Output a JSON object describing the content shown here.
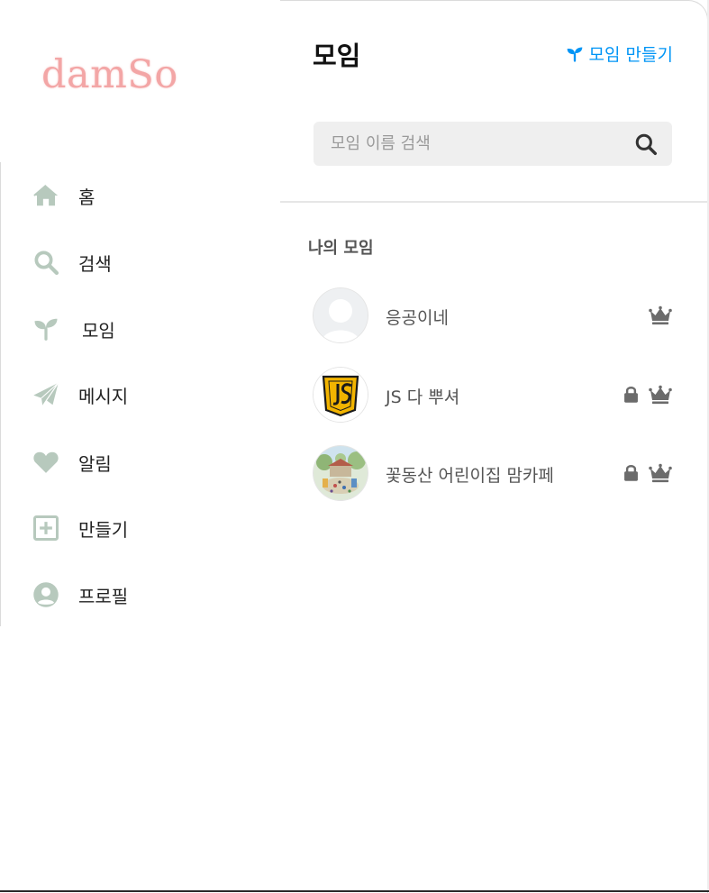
{
  "sidebar": {
    "logo": "damSo",
    "items": [
      {
        "label": "홈",
        "icon": "home-icon"
      },
      {
        "label": "검색",
        "icon": "search-icon"
      },
      {
        "label": "모임",
        "icon": "sprout-icon"
      },
      {
        "label": "메시지",
        "icon": "paper-plane-icon"
      },
      {
        "label": "알림",
        "icon": "heart-icon"
      },
      {
        "label": "만들기",
        "icon": "plus-square-icon"
      },
      {
        "label": "프로필",
        "icon": "user-circle-icon"
      }
    ]
  },
  "main": {
    "title": "모임",
    "create_label": "모임 만들기",
    "search": {
      "placeholder": "모임 이름 검색",
      "value": ""
    },
    "section_title": "나의 모임",
    "groups": [
      {
        "name": "응공이네",
        "avatar": "default-avatar",
        "locked": false,
        "owner": true
      },
      {
        "name": "JS 다 뿌셔",
        "avatar": "js-logo",
        "locked": true,
        "owner": true
      },
      {
        "name": "꽃동산 어린이집 맘카페",
        "avatar": "playground-photo",
        "locked": true,
        "owner": true
      }
    ]
  },
  "colors": {
    "accent": "#0095f6",
    "logo": "#f3a6a6",
    "nav_icon": "#b7c9bd",
    "badge": "#6b6b6b"
  }
}
